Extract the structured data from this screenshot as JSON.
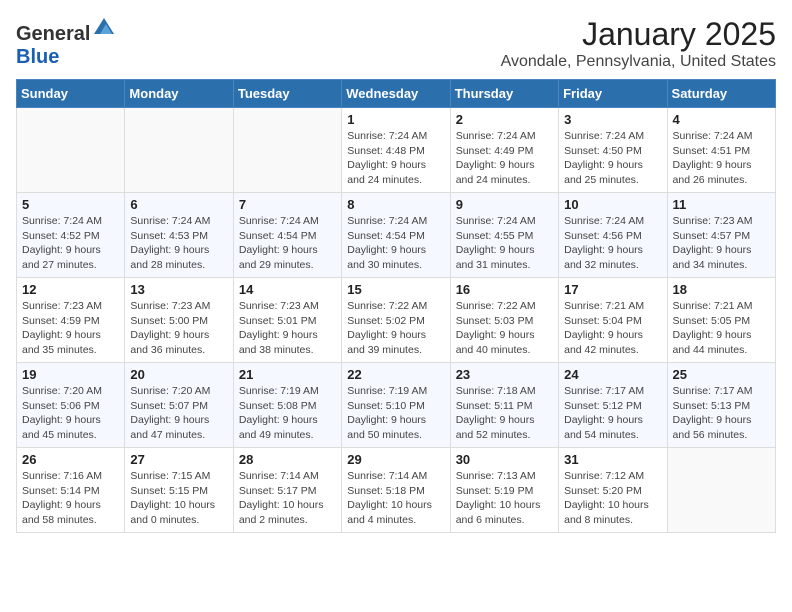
{
  "header": {
    "logo_general": "General",
    "logo_blue": "Blue",
    "month": "January 2025",
    "location": "Avondale, Pennsylvania, United States"
  },
  "weekdays": [
    "Sunday",
    "Monday",
    "Tuesday",
    "Wednesday",
    "Thursday",
    "Friday",
    "Saturday"
  ],
  "weeks": [
    [
      {
        "day": "",
        "sunrise": "",
        "sunset": "",
        "daylight": ""
      },
      {
        "day": "",
        "sunrise": "",
        "sunset": "",
        "daylight": ""
      },
      {
        "day": "",
        "sunrise": "",
        "sunset": "",
        "daylight": ""
      },
      {
        "day": "1",
        "sunrise": "Sunrise: 7:24 AM",
        "sunset": "Sunset: 4:48 PM",
        "daylight": "Daylight: 9 hours and 24 minutes."
      },
      {
        "day": "2",
        "sunrise": "Sunrise: 7:24 AM",
        "sunset": "Sunset: 4:49 PM",
        "daylight": "Daylight: 9 hours and 24 minutes."
      },
      {
        "day": "3",
        "sunrise": "Sunrise: 7:24 AM",
        "sunset": "Sunset: 4:50 PM",
        "daylight": "Daylight: 9 hours and 25 minutes."
      },
      {
        "day": "4",
        "sunrise": "Sunrise: 7:24 AM",
        "sunset": "Sunset: 4:51 PM",
        "daylight": "Daylight: 9 hours and 26 minutes."
      }
    ],
    [
      {
        "day": "5",
        "sunrise": "Sunrise: 7:24 AM",
        "sunset": "Sunset: 4:52 PM",
        "daylight": "Daylight: 9 hours and 27 minutes."
      },
      {
        "day": "6",
        "sunrise": "Sunrise: 7:24 AM",
        "sunset": "Sunset: 4:53 PM",
        "daylight": "Daylight: 9 hours and 28 minutes."
      },
      {
        "day": "7",
        "sunrise": "Sunrise: 7:24 AM",
        "sunset": "Sunset: 4:54 PM",
        "daylight": "Daylight: 9 hours and 29 minutes."
      },
      {
        "day": "8",
        "sunrise": "Sunrise: 7:24 AM",
        "sunset": "Sunset: 4:54 PM",
        "daylight": "Daylight: 9 hours and 30 minutes."
      },
      {
        "day": "9",
        "sunrise": "Sunrise: 7:24 AM",
        "sunset": "Sunset: 4:55 PM",
        "daylight": "Daylight: 9 hours and 31 minutes."
      },
      {
        "day": "10",
        "sunrise": "Sunrise: 7:24 AM",
        "sunset": "Sunset: 4:56 PM",
        "daylight": "Daylight: 9 hours and 32 minutes."
      },
      {
        "day": "11",
        "sunrise": "Sunrise: 7:23 AM",
        "sunset": "Sunset: 4:57 PM",
        "daylight": "Daylight: 9 hours and 34 minutes."
      }
    ],
    [
      {
        "day": "12",
        "sunrise": "Sunrise: 7:23 AM",
        "sunset": "Sunset: 4:59 PM",
        "daylight": "Daylight: 9 hours and 35 minutes."
      },
      {
        "day": "13",
        "sunrise": "Sunrise: 7:23 AM",
        "sunset": "Sunset: 5:00 PM",
        "daylight": "Daylight: 9 hours and 36 minutes."
      },
      {
        "day": "14",
        "sunrise": "Sunrise: 7:23 AM",
        "sunset": "Sunset: 5:01 PM",
        "daylight": "Daylight: 9 hours and 38 minutes."
      },
      {
        "day": "15",
        "sunrise": "Sunrise: 7:22 AM",
        "sunset": "Sunset: 5:02 PM",
        "daylight": "Daylight: 9 hours and 39 minutes."
      },
      {
        "day": "16",
        "sunrise": "Sunrise: 7:22 AM",
        "sunset": "Sunset: 5:03 PM",
        "daylight": "Daylight: 9 hours and 40 minutes."
      },
      {
        "day": "17",
        "sunrise": "Sunrise: 7:21 AM",
        "sunset": "Sunset: 5:04 PM",
        "daylight": "Daylight: 9 hours and 42 minutes."
      },
      {
        "day": "18",
        "sunrise": "Sunrise: 7:21 AM",
        "sunset": "Sunset: 5:05 PM",
        "daylight": "Daylight: 9 hours and 44 minutes."
      }
    ],
    [
      {
        "day": "19",
        "sunrise": "Sunrise: 7:20 AM",
        "sunset": "Sunset: 5:06 PM",
        "daylight": "Daylight: 9 hours and 45 minutes."
      },
      {
        "day": "20",
        "sunrise": "Sunrise: 7:20 AM",
        "sunset": "Sunset: 5:07 PM",
        "daylight": "Daylight: 9 hours and 47 minutes."
      },
      {
        "day": "21",
        "sunrise": "Sunrise: 7:19 AM",
        "sunset": "Sunset: 5:08 PM",
        "daylight": "Daylight: 9 hours and 49 minutes."
      },
      {
        "day": "22",
        "sunrise": "Sunrise: 7:19 AM",
        "sunset": "Sunset: 5:10 PM",
        "daylight": "Daylight: 9 hours and 50 minutes."
      },
      {
        "day": "23",
        "sunrise": "Sunrise: 7:18 AM",
        "sunset": "Sunset: 5:11 PM",
        "daylight": "Daylight: 9 hours and 52 minutes."
      },
      {
        "day": "24",
        "sunrise": "Sunrise: 7:17 AM",
        "sunset": "Sunset: 5:12 PM",
        "daylight": "Daylight: 9 hours and 54 minutes."
      },
      {
        "day": "25",
        "sunrise": "Sunrise: 7:17 AM",
        "sunset": "Sunset: 5:13 PM",
        "daylight": "Daylight: 9 hours and 56 minutes."
      }
    ],
    [
      {
        "day": "26",
        "sunrise": "Sunrise: 7:16 AM",
        "sunset": "Sunset: 5:14 PM",
        "daylight": "Daylight: 9 hours and 58 minutes."
      },
      {
        "day": "27",
        "sunrise": "Sunrise: 7:15 AM",
        "sunset": "Sunset: 5:15 PM",
        "daylight": "Daylight: 10 hours and 0 minutes."
      },
      {
        "day": "28",
        "sunrise": "Sunrise: 7:14 AM",
        "sunset": "Sunset: 5:17 PM",
        "daylight": "Daylight: 10 hours and 2 minutes."
      },
      {
        "day": "29",
        "sunrise": "Sunrise: 7:14 AM",
        "sunset": "Sunset: 5:18 PM",
        "daylight": "Daylight: 10 hours and 4 minutes."
      },
      {
        "day": "30",
        "sunrise": "Sunrise: 7:13 AM",
        "sunset": "Sunset: 5:19 PM",
        "daylight": "Daylight: 10 hours and 6 minutes."
      },
      {
        "day": "31",
        "sunrise": "Sunrise: 7:12 AM",
        "sunset": "Sunset: 5:20 PM",
        "daylight": "Daylight: 10 hours and 8 minutes."
      },
      {
        "day": "",
        "sunrise": "",
        "sunset": "",
        "daylight": ""
      }
    ]
  ]
}
